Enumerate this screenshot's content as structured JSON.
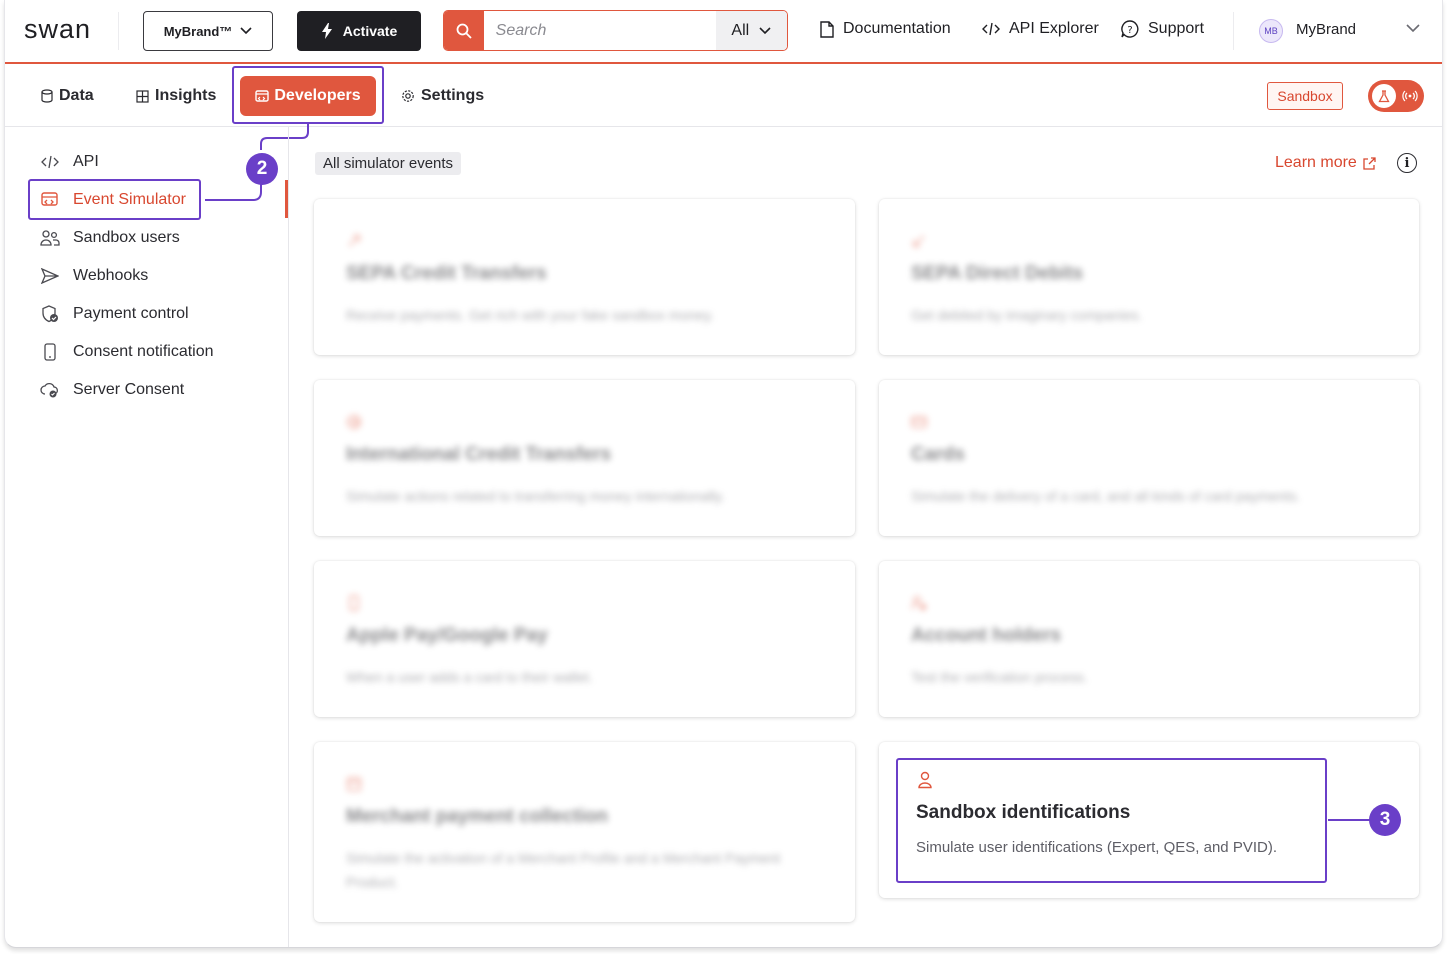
{
  "topbar": {
    "logo": "swan",
    "brand_selector": "MyBrand™",
    "activate_label": "Activate",
    "search_placeholder": "Search",
    "search_scope": "All",
    "documentation": "Documentation",
    "api_explorer": "API Explorer",
    "support": "Support",
    "avatar_initials": "MB",
    "user_name": "MyBrand"
  },
  "tabs": {
    "data": "Data",
    "insights": "Insights",
    "developers": "Developers",
    "settings": "Settings",
    "env_badge": "Sandbox"
  },
  "sidebar": {
    "items": [
      {
        "label": "API",
        "icon": "code-icon"
      },
      {
        "label": "Event Simulator",
        "icon": "simulator-icon",
        "active": true
      },
      {
        "label": "Sandbox users",
        "icon": "users-icon"
      },
      {
        "label": "Webhooks",
        "icon": "send-icon"
      },
      {
        "label": "Payment control",
        "icon": "shield-check-icon"
      },
      {
        "label": "Consent notification",
        "icon": "phone-icon"
      },
      {
        "label": "Server Consent",
        "icon": "cloud-icon"
      }
    ]
  },
  "content": {
    "filter_chip": "All simulator events",
    "learn_more": "Learn more",
    "cards": [
      {
        "title": "SEPA Credit Transfers",
        "description": "Receive payments. Get rich with your fake sandbox money."
      },
      {
        "title": "SEPA Direct Debits",
        "description": "Get debited by imaginary companies."
      },
      {
        "title": "International Credit Transfers",
        "description": "Simulate actions related to transferring money internationally."
      },
      {
        "title": "Cards",
        "description": "Simulate the delivery of a card, and all kinds of card payments."
      },
      {
        "title": "Apple Pay/Google Pay",
        "description": "When a user adds a card to their wallet."
      },
      {
        "title": "Account holders",
        "description": "Test the verification process."
      },
      {
        "title": "Merchant payment collection",
        "description": "Simulate the activation of a Merchant Profile and a Merchant Payment Product."
      },
      {
        "title": "Sandbox identifications",
        "description": "Simulate user identifications (Expert, QES, and PVID)."
      }
    ]
  },
  "callouts": {
    "step2": "2",
    "step3": "3"
  },
  "colors": {
    "accent": "#e0573e",
    "highlight": "#6a3fc8",
    "text": "#1f1f23"
  }
}
